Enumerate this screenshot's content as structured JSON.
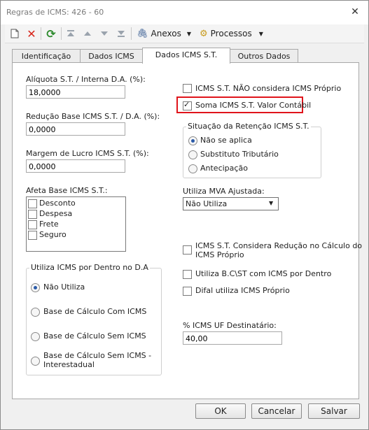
{
  "window": {
    "title": "Regras de ICMS: 426 - 60"
  },
  "toolbar": {
    "anexos": "Anexos",
    "processos": "Processos"
  },
  "tabs": [
    "Identificação",
    "Dados ICMS",
    "Dados ICMS S.T.",
    "Outros Dados"
  ],
  "left": {
    "aliquota_label": "Alíquota S.T. / Interna D.A. (%):",
    "aliquota_value": "18,0000",
    "reducao_label": "Redução Base ICMS S.T. / D.A. (%):",
    "reducao_value": "0,0000",
    "margem_label": "Margem de Lucro ICMS S.T. (%):",
    "margem_value": "0,0000",
    "afeta_label": "Afeta Base ICMS S.T.:",
    "afeta_items": [
      "Desconto",
      "Despesa",
      "Frete",
      "Seguro"
    ],
    "dentro_title": "Utiliza ICMS por Dentro no D.A",
    "dentro_options": [
      "Não Utiliza",
      "Base de Cálculo Com ICMS",
      "Base de Cálculo Sem ICMS",
      "Base de Cálculo Sem ICMS -",
      "Interestadual"
    ]
  },
  "right": {
    "nao_considera": "ICMS S.T. NÃO considera ICMS Próprio",
    "soma_valor": "Soma ICMS S.T. Valor Contábil",
    "situacao_title": "Situação da Retenção ICMS S.T.",
    "situacao_options": [
      "Não se aplica",
      "Substituto Tributário",
      "Antecipação"
    ],
    "mva_label": "Utiliza MVA Ajustada:",
    "mva_value": "Não Utiliza",
    "considera_reducao_1": "ICMS S.T. Considera Redução no Cálculo do",
    "considera_reducao_2": "ICMS Próprio",
    "utiliza_bc": "Utiliza B.C\\ST com ICMS por Dentro",
    "difal": "Difal utiliza ICMS Próprio",
    "uf_label": "% ICMS UF Destinatário:",
    "uf_value": "40,00"
  },
  "buttons": {
    "ok": "OK",
    "cancel": "Cancelar",
    "save": "Salvar"
  }
}
